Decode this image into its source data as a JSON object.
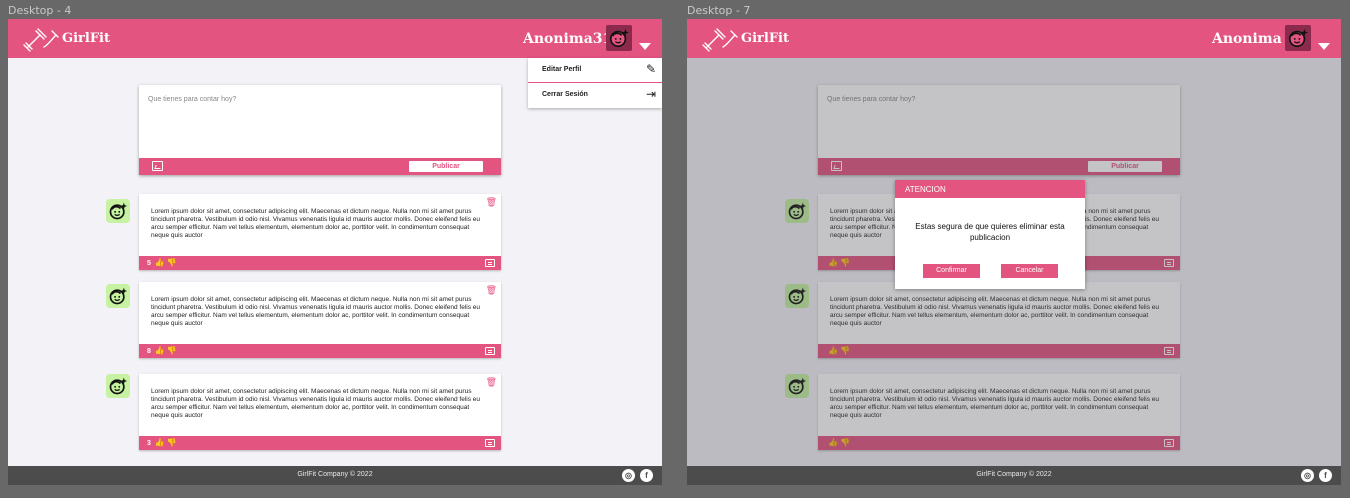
{
  "frames": [
    {
      "label": "Desktop - 4",
      "brand": "GirlFit",
      "username": "Anonima31",
      "menu": {
        "items": [
          {
            "label": "Editar Perfil",
            "icon": "pencil-icon"
          },
          {
            "label": "Cerrar Sesión",
            "icon": "logout-icon"
          }
        ]
      },
      "composer": {
        "placeholder": "Que tienes para contar hoy?",
        "publish_label": "Publicar"
      },
      "posts": [
        {
          "text": "Lorem ipsum dolor sit amet, consectetur adipiscing elit. Maecenas et dictum neque. Nulla non mi sit amet purus tincidunt pharetra. Vestibulum id odio nisl. Vivamus venenatis ligula id mauris auctor mollis. Donec eleifend felis eu arcu semper efficitur. Nam vel tellus elementum, elementum dolor ac, porttitor velit. In condimentum consequat neque quis auctor",
          "likes": "5"
        },
        {
          "text": "Lorem ipsum dolor sit amet, consectetur adipiscing elit. Maecenas et dictum neque. Nulla non mi sit amet purus tincidunt pharetra. Vestibulum id odio nisl. Vivamus venenatis ligula id mauris auctor mollis. Donec eleifend felis eu arcu semper efficitur. Nam vel tellus elementum, elementum dolor ac, porttitor velit. In condimentum consequat neque quis auctor",
          "likes": "8"
        },
        {
          "text": "Lorem ipsum dolor sit amet, consectetur adipiscing elit. Maecenas et dictum neque. Nulla non mi sit amet purus tincidunt pharetra. Vestibulum id odio nisl. Vivamus venenatis ligula id mauris auctor mollis. Donec eleifend felis eu arcu semper efficitur. Nam vel tellus elementum, elementum dolor ac, porttitor velit. In condimentum consequat neque quis auctor",
          "likes": "3"
        }
      ],
      "footer": "GirlFit Company  © 2022"
    },
    {
      "label": "Desktop - 7",
      "brand": "GirlFit",
      "username": "Anonima",
      "composer": {
        "placeholder": "Que tienes para contar hoy?",
        "publish_label": "Publicar"
      },
      "posts": [
        {
          "text": "Lorem ipsum dolor sit amet, consectetur adipiscing elit. Maecenas et dictum neque. Nulla non mi sit amet purus tincidunt pharetra. Vestibulum id odio nisl. Vivamus venenatis ligula id mauris auctor mollis. Donec eleifend felis eu arcu semper efficitur. Nam vel tellus elementum, elementum dolor ac, porttitor velit. In condimentum consequat neque quis auctor"
        },
        {
          "text": "Lorem ipsum dolor sit amet, consectetur adipiscing elit. Maecenas et dictum neque. Nulla non mi sit amet purus tincidunt pharetra. Vestibulum id odio nisl. Vivamus venenatis ligula id mauris auctor mollis. Donec eleifend felis eu arcu semper efficitur. Nam vel tellus elementum, elementum dolor ac, porttitor velit. In condimentum consequat neque quis auctor"
        },
        {
          "text": "Lorem ipsum dolor sit amet, consectetur adipiscing elit. Maecenas et dictum neque. Nulla non mi sit amet purus tincidunt pharetra. Vestibulum id odio nisl. Vivamus venenatis ligula id mauris auctor mollis. Donec eleifend felis eu arcu semper efficitur. Nam vel tellus elementum, elementum dolor ac, porttitor velit. In condimentum consequat neque quis auctor"
        }
      ],
      "dialog": {
        "title": "ATENCION",
        "message": "Estas segura de que quieres eliminar esta publicacion",
        "confirm": "Confirmar",
        "cancel": "Cancelar"
      },
      "footer": "GirlFit Company  © 2022"
    }
  ],
  "colors": {
    "brand_pink": "#e35480",
    "canvas": "#686868",
    "footer": "#4c4c4c",
    "page_bg": "#f3f2f6",
    "avatar_green": "#c6f2a1"
  },
  "icons": [
    "dumbbell-logo-icon",
    "avatar-face-icon",
    "chevron-down-icon",
    "image-icon",
    "trash-icon",
    "thumbs-up-icon",
    "thumbs-down-icon",
    "comment-icon",
    "instagram-icon",
    "facebook-icon",
    "pencil-icon",
    "logout-icon"
  ]
}
